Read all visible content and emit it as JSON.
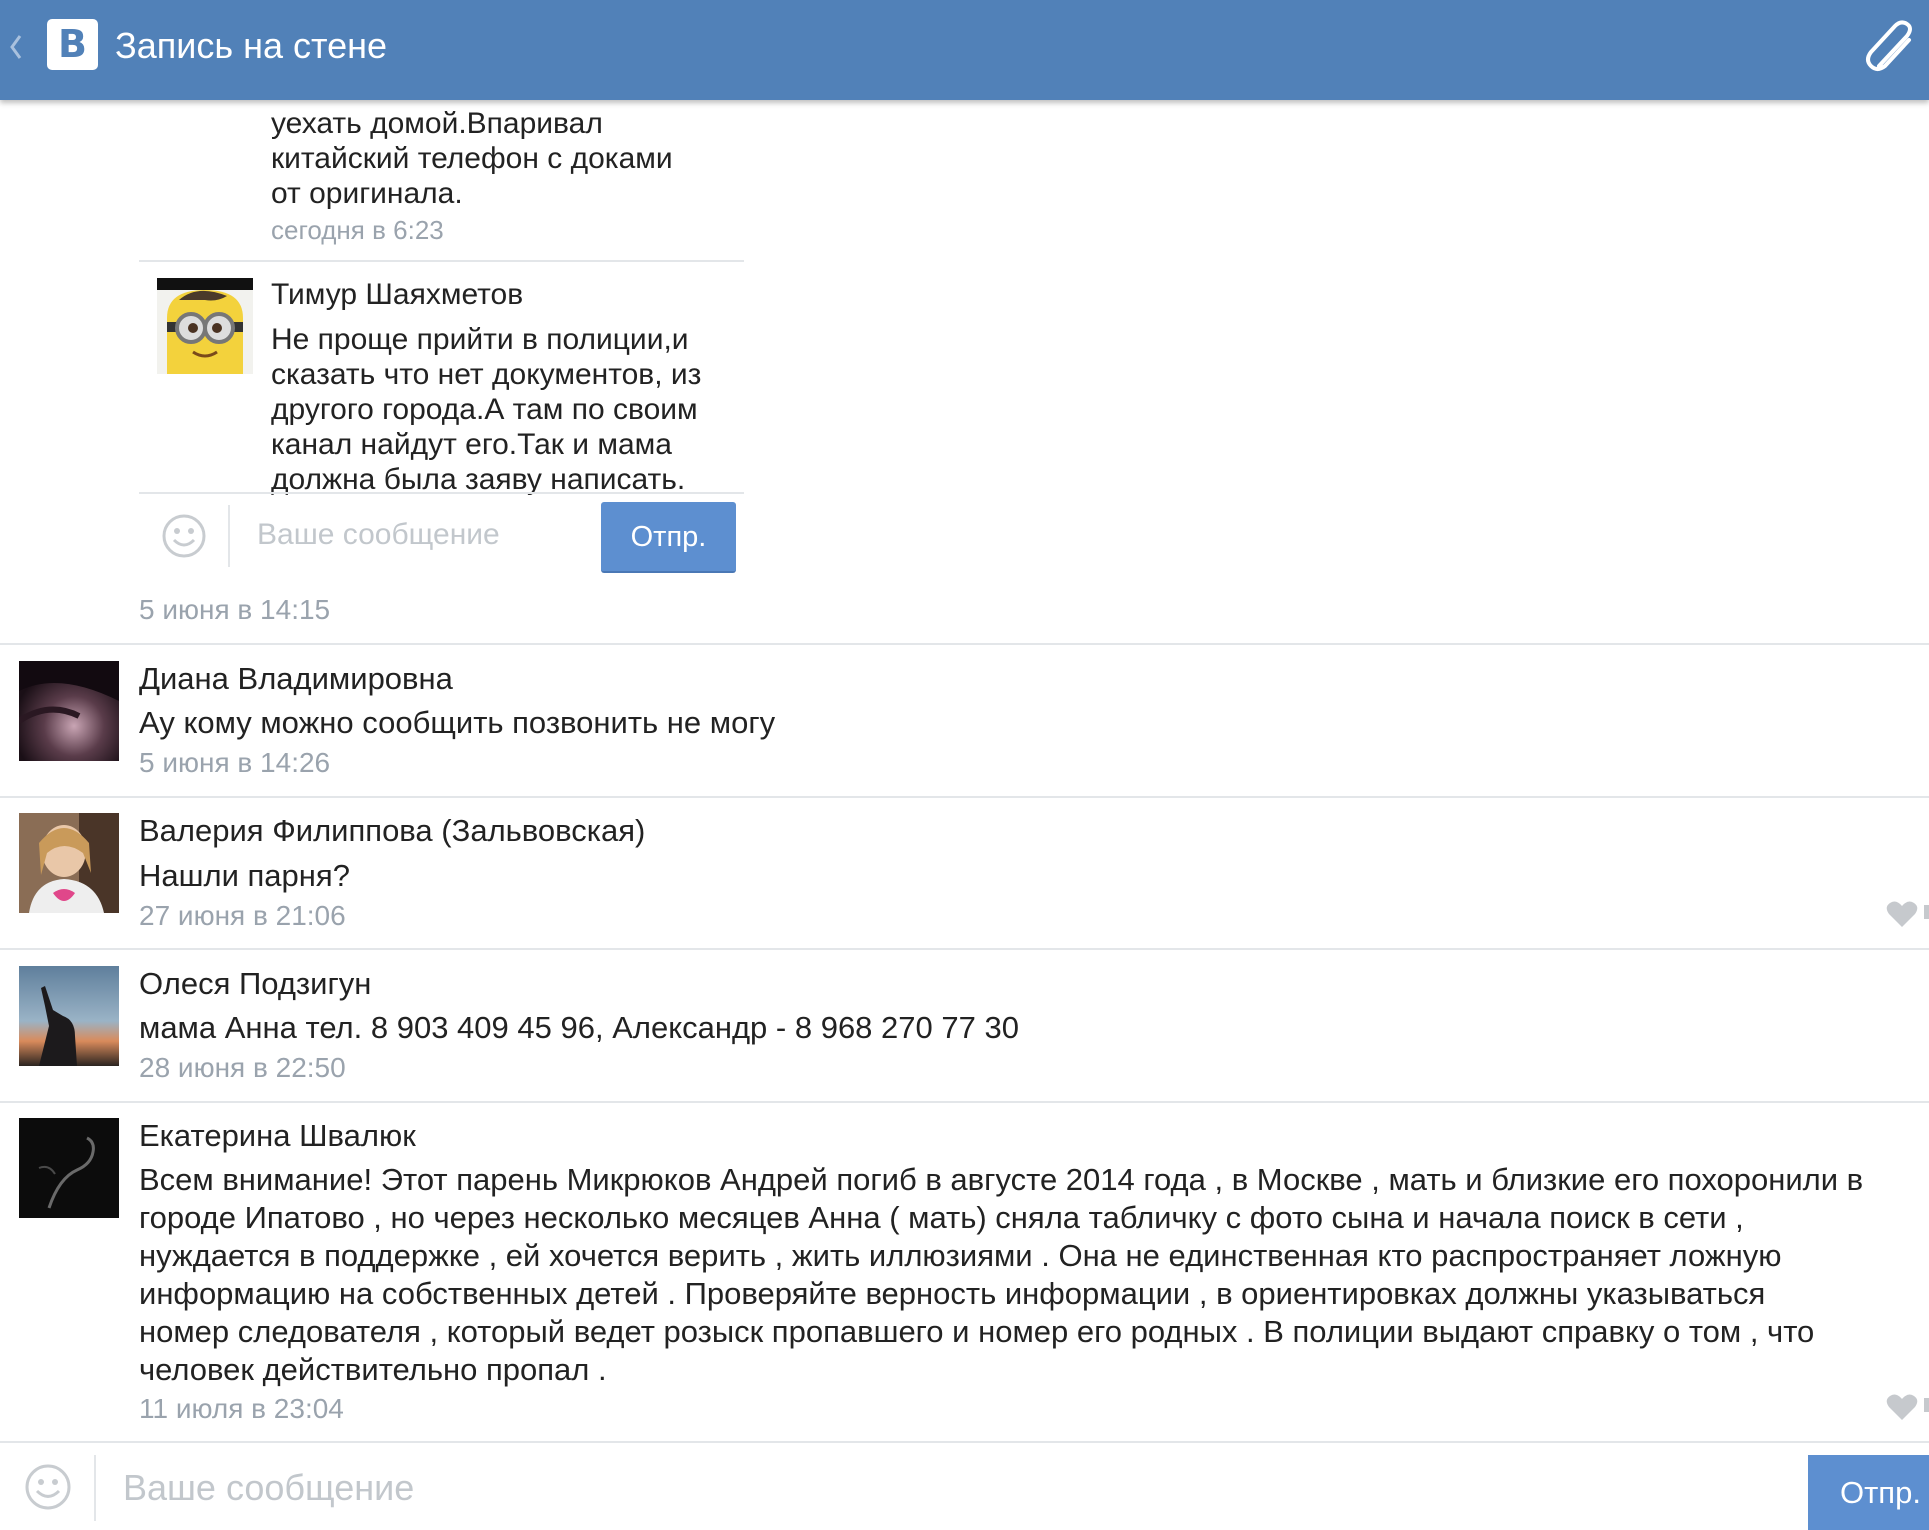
{
  "header": {
    "title": "Запись на стене",
    "logo_letter": "B",
    "back_icon": "chevron-left-icon",
    "attach_icon": "paperclip-icon"
  },
  "nested_thread": {
    "prev_comment_lines": [
      "уехать домой.Впаривал",
      "китайский телефон с доками",
      "от оригинала."
    ],
    "prev_comment_date": "сегодня в 6:23",
    "reply": {
      "name": "Тимур Шаяхметов",
      "lines": [
        "Не проще прийти в полиции,и",
        "сказать что нет документов, из",
        "другого города.А там по своим",
        "канал найдут его.Так и мама",
        "должна была заяву написать."
      ]
    },
    "input_placeholder": "Ваше сообщение",
    "send_label": "Отпр.",
    "post_date": "5 июня в 14:15"
  },
  "comments": [
    {
      "name": "Диана Владимировна",
      "text": "Ау кому можно сообщить позвонить не могу",
      "date": "5 июня в 14:26"
    },
    {
      "name": "Валерия Филиппова (Зальвовская)",
      "text": "Нашли парня?",
      "date": "27 июня в 21:06"
    },
    {
      "name": "Олеся Подзигун",
      "text": "мама Анна тел. 8 903 409 45 96, Александр - 8 968 270 77 30",
      "date": "28 июня в 22:50"
    },
    {
      "name": "Екатерина Швалюк",
      "lines": [
        "Всем внимание! Этот парень Микрюков Андрей погиб в августе 2014 года , в Москве , мать и близкие его похоронили в",
        "городе Ипатово , но через несколько месяцев Анна ( мать) сняла табличку с фото сына и начала поиск в сети ,",
        "нуждается в поддержке , ей хочется верить , жить иллюзиями . Она не единственная кто распространяет ложную",
        "информацию на собственных детей . Проверяйте верность информации , в ориентировках должны указываться",
        "номер следователя , который ведет розыск пропавшего и номер его родных . В полиции выдают справку о том , что",
        "человек действительно пропал ."
      ],
      "date": "11 июля в 23:04"
    }
  ],
  "composer": {
    "placeholder": "Ваше сообщение",
    "send_label": "Отпр."
  },
  "colors": {
    "header_bg": "#5181b8",
    "send_button": "#5d8fd0",
    "date_text": "#9aa3ad",
    "separator": "#e3e6e9"
  }
}
